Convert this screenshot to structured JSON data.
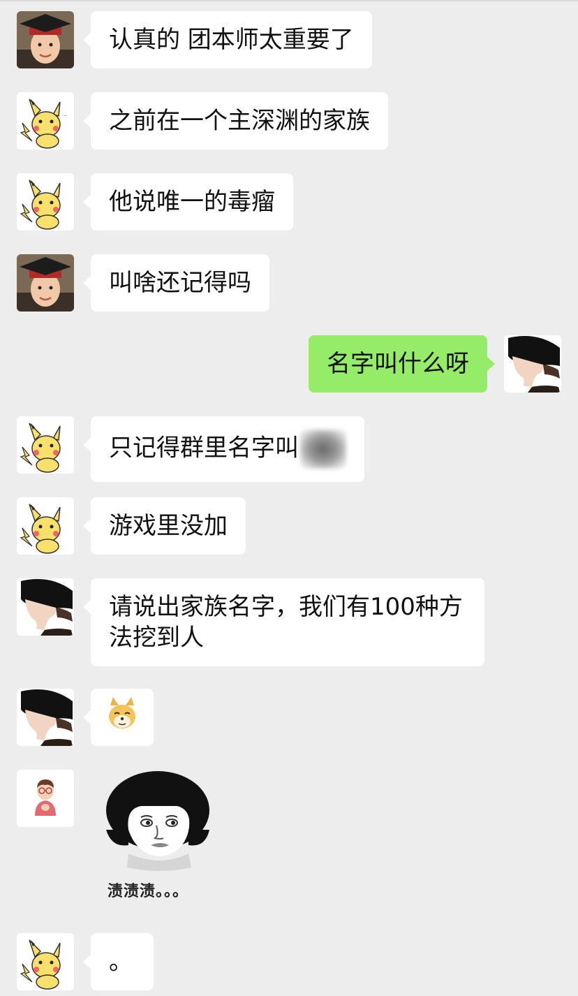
{
  "messages": [
    {
      "side": "left",
      "avatar": "graduate-boy",
      "text": "认真的 团本师太重要了"
    },
    {
      "side": "left",
      "avatar": "pikachu",
      "text": "之前在一个主深渊的家族"
    },
    {
      "side": "left",
      "avatar": "pikachu",
      "text": "他说唯一的毒瘤"
    },
    {
      "side": "left",
      "avatar": "graduate-boy",
      "text": "叫啥还记得吗"
    },
    {
      "side": "right",
      "avatar": "dark-hair-profile",
      "text": "名字叫什么呀"
    },
    {
      "side": "left",
      "avatar": "pikachu",
      "text": "只记得群里名字叫"
    },
    {
      "side": "left",
      "avatar": "pikachu",
      "text": "游戏里没加"
    },
    {
      "side": "left",
      "avatar": "dark-hair-profile",
      "text": "请说出家族名字，我们有100种方法挖到人"
    },
    {
      "side": "left",
      "avatar": "dark-hair-profile",
      "emoji": "doge-emoji"
    },
    {
      "side": "left",
      "avatar": "cartoon-boy-glasses",
      "sticker": "bowl-cut-face-sticker",
      "caption": "渍渍渍。。。"
    },
    {
      "side": "left",
      "avatar": "pikachu",
      "text": "。"
    }
  ],
  "colors": {
    "background": "#ededed",
    "incoming_bubble": "#ffffff",
    "outgoing_bubble": "#95ec69",
    "text": "#111111"
  }
}
